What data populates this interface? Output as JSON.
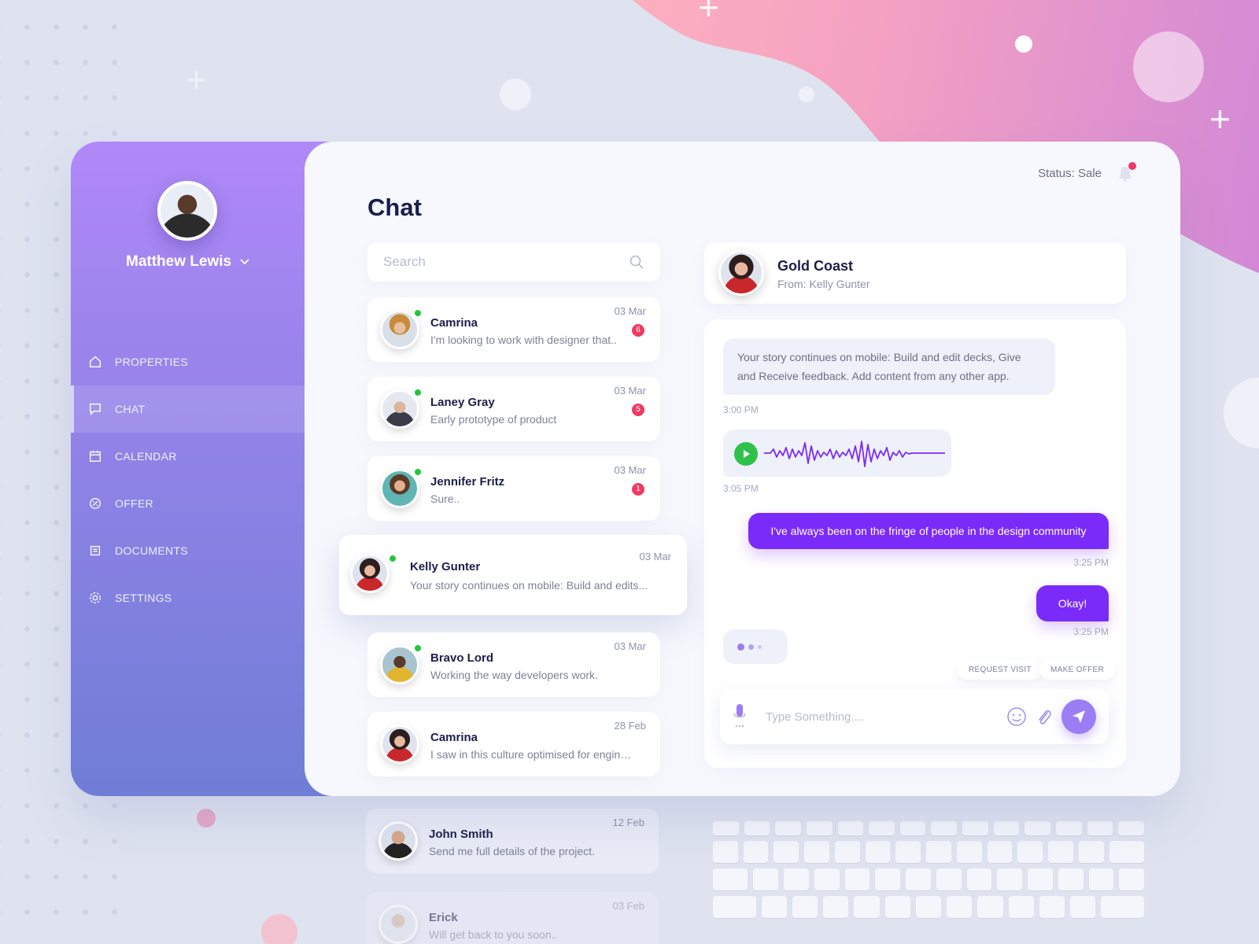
{
  "user": {
    "name": "Matthew Lewis"
  },
  "nav": [
    {
      "label": "PROPERTIES",
      "icon": "home-icon",
      "active": false
    },
    {
      "label": "CHAT",
      "icon": "chat-icon",
      "active": true
    },
    {
      "label": "CALENDAR",
      "icon": "calendar-icon",
      "active": false
    },
    {
      "label": "OFFER",
      "icon": "offer-icon",
      "active": false
    },
    {
      "label": "DOCUMENTS",
      "icon": "documents-icon",
      "active": false
    },
    {
      "label": "SETTINGS",
      "icon": "settings-icon",
      "active": false
    }
  ],
  "header": {
    "title": "Chat",
    "status": "Status: Sale",
    "notifications": "1"
  },
  "search": {
    "placeholder": "Search"
  },
  "contacts": [
    {
      "name": "Camrina",
      "message": "I'm looking to work with designer that..",
      "date": "03 Mar",
      "unread": "6",
      "online": true
    },
    {
      "name": "Laney Gray",
      "message": "Early prototype of product",
      "date": "03 Mar",
      "unread": "5",
      "online": true
    },
    {
      "name": "Jennifer Fritz",
      "message": "Sure..",
      "date": "03 Mar",
      "unread": "1",
      "online": true
    },
    {
      "name": "Kelly Gunter",
      "message": "Your story continues on mobile: Build and edits...",
      "date": "03 Mar",
      "online": true,
      "active": true
    },
    {
      "name": "Bravo Lord",
      "message": "Working the way developers work.",
      "date": "03 Mar",
      "online": true
    },
    {
      "name": "Camrina",
      "message": "I saw in this culture optimised for engine...",
      "date": "28 Feb",
      "online": false
    },
    {
      "name": "John Smith",
      "message": "Send me full details of the project.",
      "date": "12 Feb",
      "online": false
    },
    {
      "name": "Erick",
      "message": "Will get back to you soon..",
      "date": "03 Feb",
      "online": false
    }
  ],
  "conversation": {
    "title": "Gold Coast",
    "subtitle": "From: Kelly Gunter",
    "messages": [
      {
        "type": "in",
        "text": "Your story continues on mobile: Build and edit decks, Give and Receive feedback. Add content from any other app.",
        "time": "3:00 PM"
      },
      {
        "type": "audio",
        "time": "3:05 PM"
      },
      {
        "type": "out",
        "text": "I've always been on the fringe of people in the design community",
        "time": "3:25 PM"
      },
      {
        "type": "out",
        "text": "Okay!",
        "time": "3:25 PM"
      }
    ],
    "quick_actions": [
      "REQUEST VISIT",
      "MAKE OFFER"
    ],
    "composer_placeholder": "Type Something...."
  },
  "colors": {
    "accent": "#7b2bf9",
    "online": "#23c63a",
    "badge": "#ef3a63"
  }
}
